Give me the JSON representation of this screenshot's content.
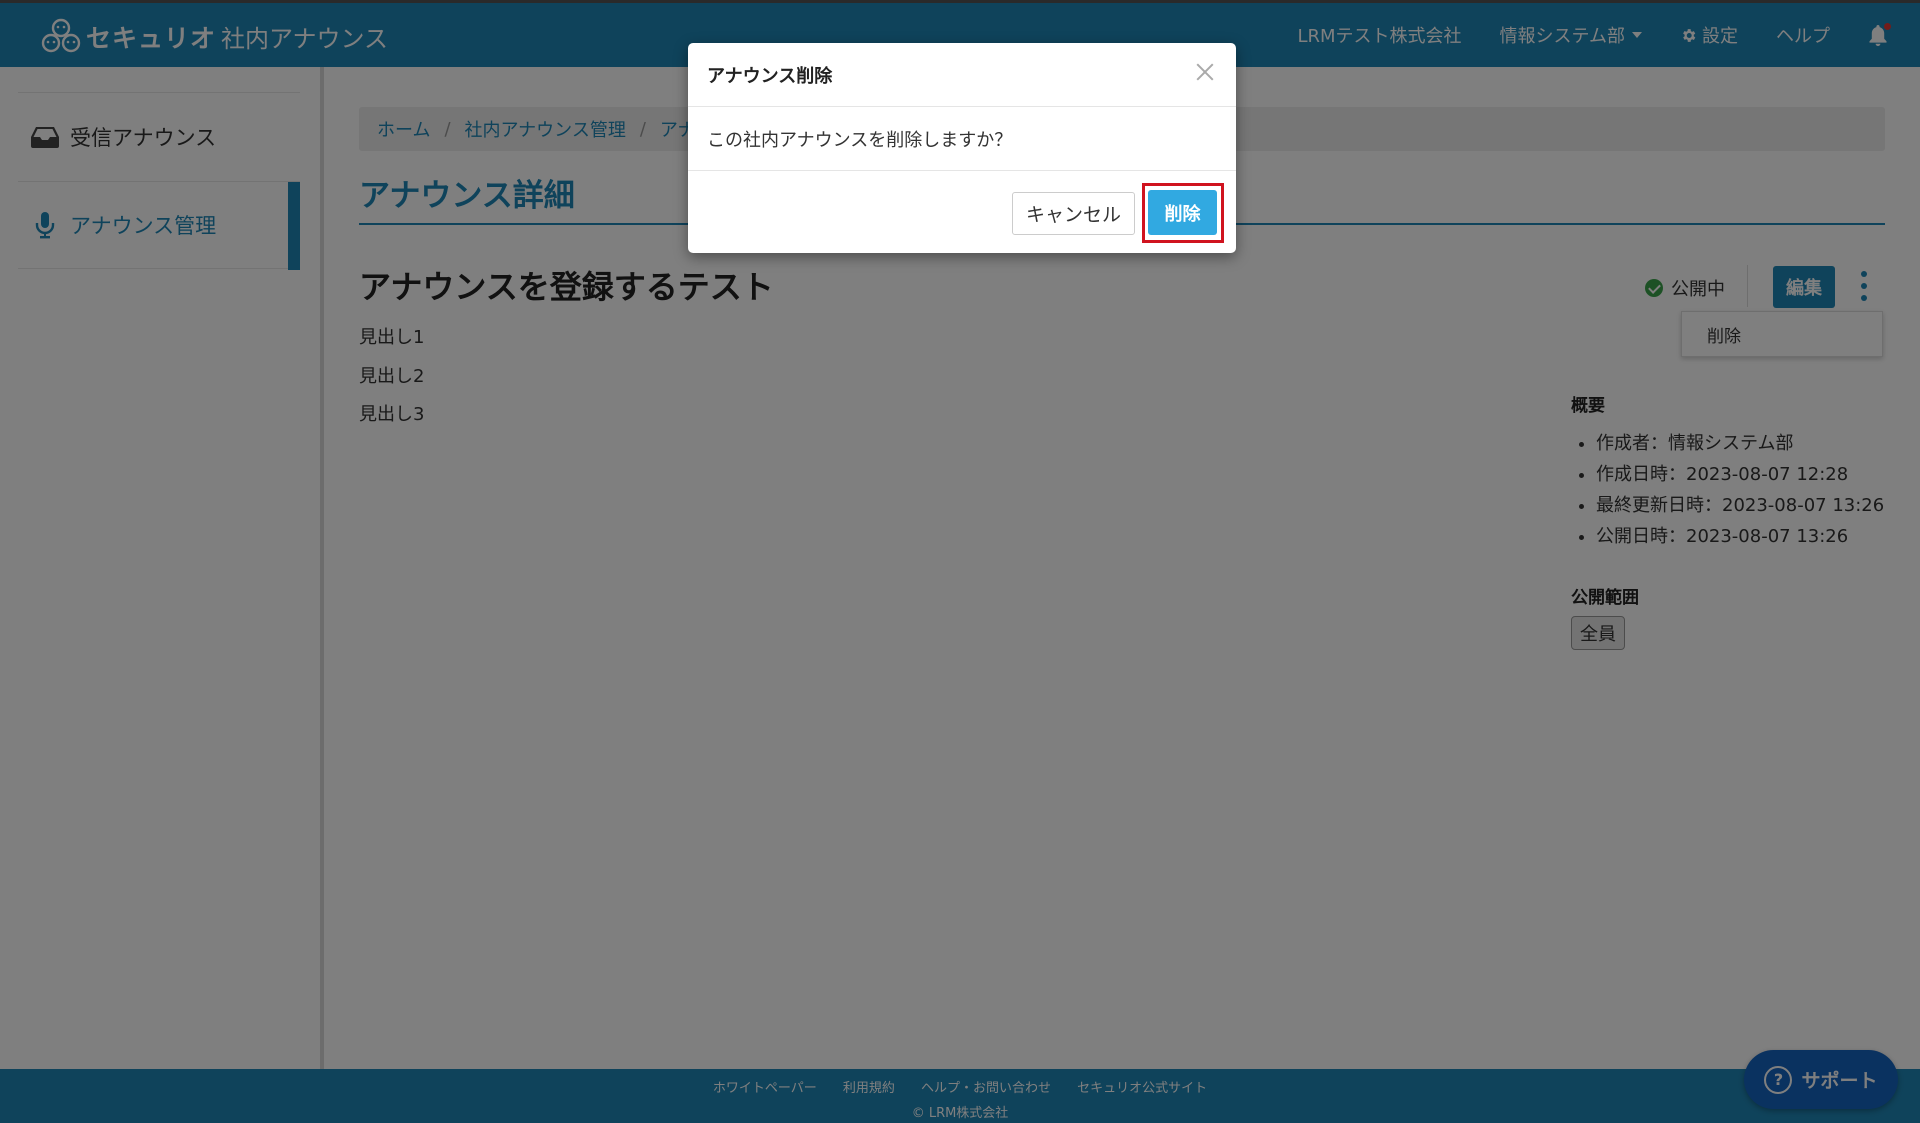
{
  "header": {
    "logo_text": "セキュリオ",
    "app_name": "社内アナウンス",
    "company": "LRMテスト株式会社",
    "department": "情報システム部",
    "settings": "設定",
    "help": "ヘルプ"
  },
  "sidebar": {
    "items": [
      {
        "label": "受信アナウンス",
        "icon": "inbox-icon"
      },
      {
        "label": "アナウンス管理",
        "icon": "microphone-icon",
        "active": true
      }
    ]
  },
  "breadcrumb": [
    "ホーム",
    "社内アナウンス管理",
    "アナ"
  ],
  "page_title": "アナウンス詳細",
  "announcement": {
    "title": "アナウンスを登録するテスト",
    "headings": [
      "見出し1",
      "見出し2",
      "見出し3"
    ],
    "status": "公開中",
    "edit_label": "編集",
    "menu_delete": "削除"
  },
  "overview": {
    "heading": "概要",
    "items": [
      "作成者：情報システム部",
      "作成日時：2023-08-07 12:28",
      "最終更新日時：2023-08-07 13:26",
      "公開日時：2023-08-07 13:26"
    ]
  },
  "scope": {
    "heading": "公開範囲",
    "value": "全員"
  },
  "footer": {
    "links": [
      "ホワイトペーパー",
      "利用規約",
      "ヘルプ・お問い合わせ",
      "セキュリオ公式サイト"
    ],
    "copyright": "© LRM株式会社"
  },
  "support_label": "サポート",
  "modal": {
    "title": "アナウンス削除",
    "message": "この社内アナウンスを削除しますか？",
    "cancel": "キャンセル",
    "confirm": "削除"
  },
  "colors": {
    "brand": "#1f86b6",
    "confirm_button": "#31a9e1",
    "highlight": "#d0131f",
    "status_ok": "#3aa34a"
  }
}
